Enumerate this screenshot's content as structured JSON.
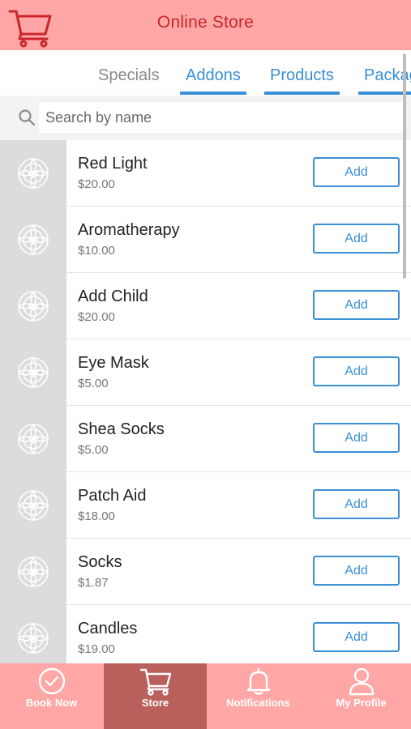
{
  "header": {
    "title": "Online Store",
    "cart_icon": "cart-icon"
  },
  "tabs": [
    {
      "label": "Specials",
      "active": false
    },
    {
      "label": "Addons",
      "active": true
    },
    {
      "label": "Products",
      "active": false
    },
    {
      "label": "Packag",
      "active": false
    }
  ],
  "search": {
    "placeholder": "Search by name",
    "value": ""
  },
  "products": [
    {
      "name": "Red Light",
      "price": "$20.00",
      "button": "Add"
    },
    {
      "name": "Aromatherapy",
      "price": "$10.00",
      "button": "Add"
    },
    {
      "name": "Add Child",
      "price": "$20.00",
      "button": "Add"
    },
    {
      "name": "Eye Mask",
      "price": "$5.00",
      "button": "Add"
    },
    {
      "name": "Shea Socks",
      "price": "$5.00",
      "button": "Add"
    },
    {
      "name": "Patch Aid",
      "price": "$18.00",
      "button": "Add"
    },
    {
      "name": "Socks",
      "price": "$1.87",
      "button": "Add"
    },
    {
      "name": "Candles",
      "price": "$19.00",
      "button": "Add"
    }
  ],
  "nav": [
    {
      "label": "Book Now",
      "icon": "check-circle-icon",
      "active": false
    },
    {
      "label": "Store",
      "icon": "cart-icon",
      "active": true
    },
    {
      "label": "Notifications",
      "icon": "bell-icon",
      "active": false
    },
    {
      "label": "My Profile",
      "icon": "user-icon",
      "active": false
    }
  ],
  "colors": {
    "header_bg": "#ffa7a7",
    "title": "#c8262a",
    "accent_blue": "#3b8fd6",
    "nav_active": "#b9605c"
  }
}
